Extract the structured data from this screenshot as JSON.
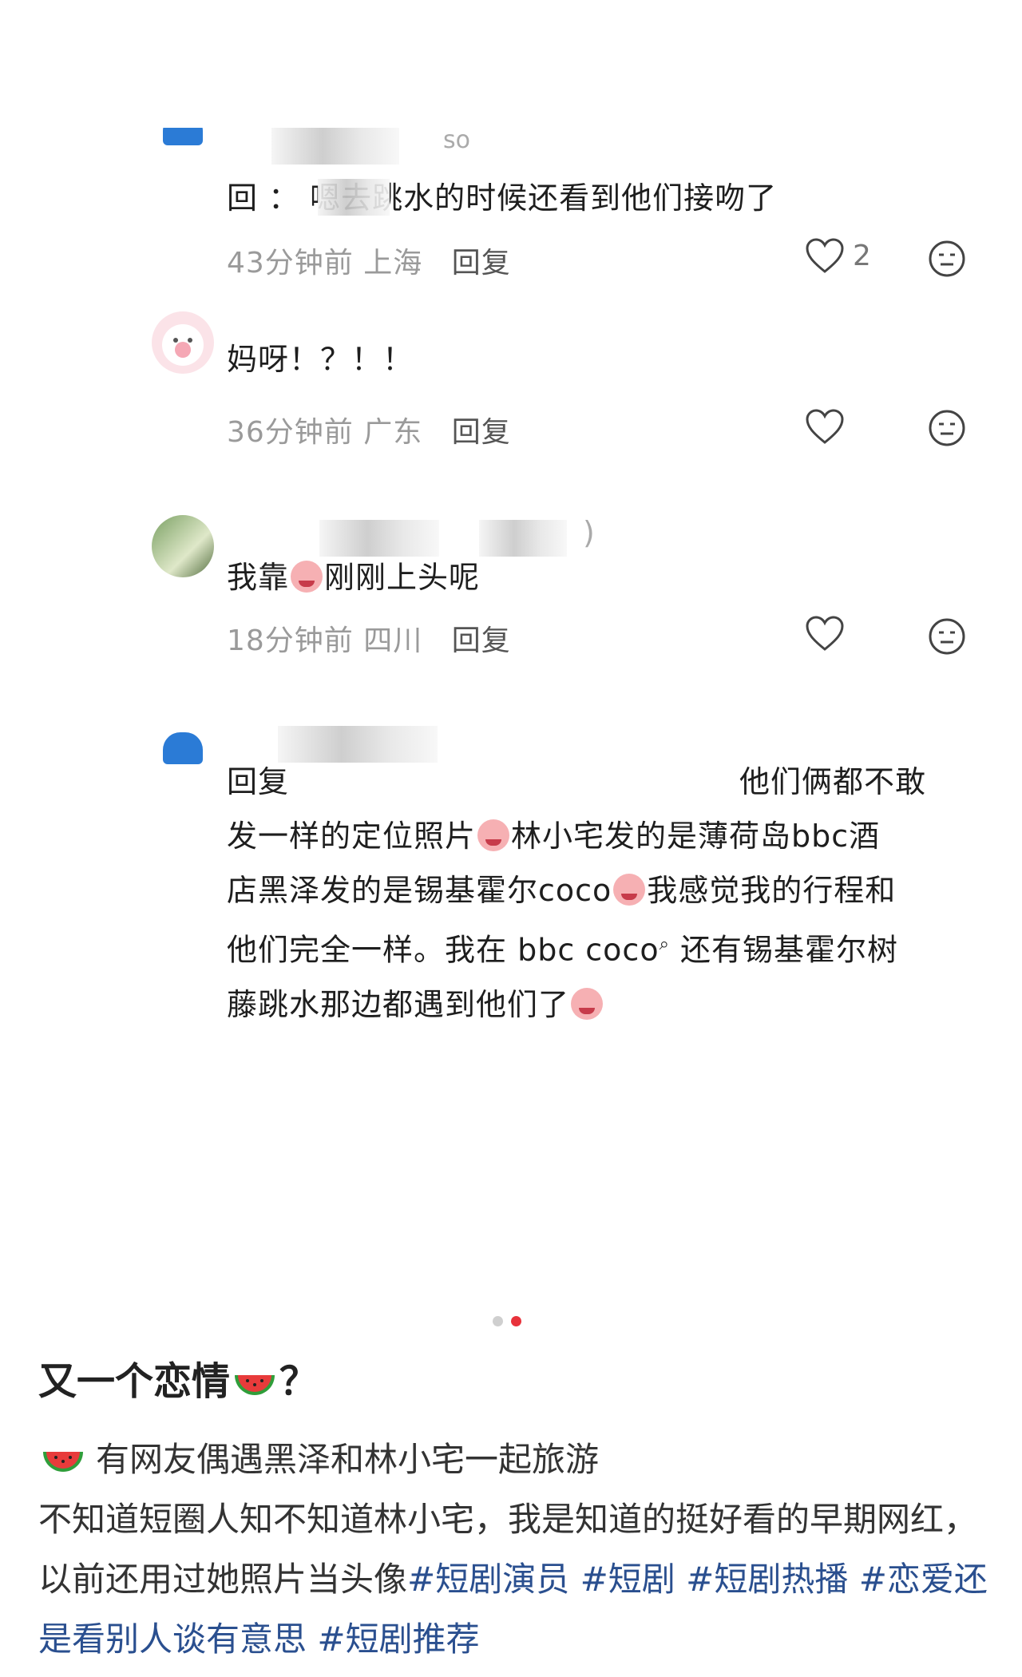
{
  "comments": [
    {
      "name_tail": "so",
      "text": "回          ： 嗯去跳水的时候还看到他们接吻了",
      "time": "43分钟前",
      "location": "上海",
      "reply_label": "回复",
      "like_count": "2"
    },
    {
      "text": "妈呀！？！！",
      "time": "36分钟前",
      "location": "广东",
      "reply_label": "回复"
    },
    {
      "name_tail": ")",
      "text_before": "我靠",
      "text_after": "刚刚上头呢",
      "time": "18分钟前",
      "location": "四川",
      "reply_label": "回复"
    },
    {
      "reply_prefix": "回复",
      "line1_end": "他们俩都不敢",
      "line2_a": "发一样的定位照片",
      "line2_b": "林小宅发的是薄荷岛bbc酒",
      "line3_a": "店黑泽发的是锡基霍尔coco",
      "line3_b": "我感觉我的行程和",
      "line4": "他们完全一样。我在 bbc coco",
      "line4_b": "还有锡基霍尔树",
      "line5": "藤跳水那边都遇到他们了"
    }
  ],
  "post": {
    "title_before": "又一个恋情",
    "title_after": "？",
    "line1": "有网友偶遇黑泽和林小宅一起旅游",
    "line2": "不知道短圈人知不知道林小宅，我是知道的挺好看的早期网红，以前还用过她照片当头像",
    "tags": [
      "#短剧演员",
      "#短剧",
      "#短剧热播",
      "#恋爱还是看别人谈有意思",
      "#短剧推荐"
    ]
  },
  "icons": [
    "heart-icon",
    "neutral-emoji-icon",
    "crying-emoji-icon",
    "watermelon-icon"
  ],
  "colors": {
    "tag": "#2a4f8f",
    "dot_active": "#e8323b",
    "avatar_blue": "#2b7bd6"
  }
}
